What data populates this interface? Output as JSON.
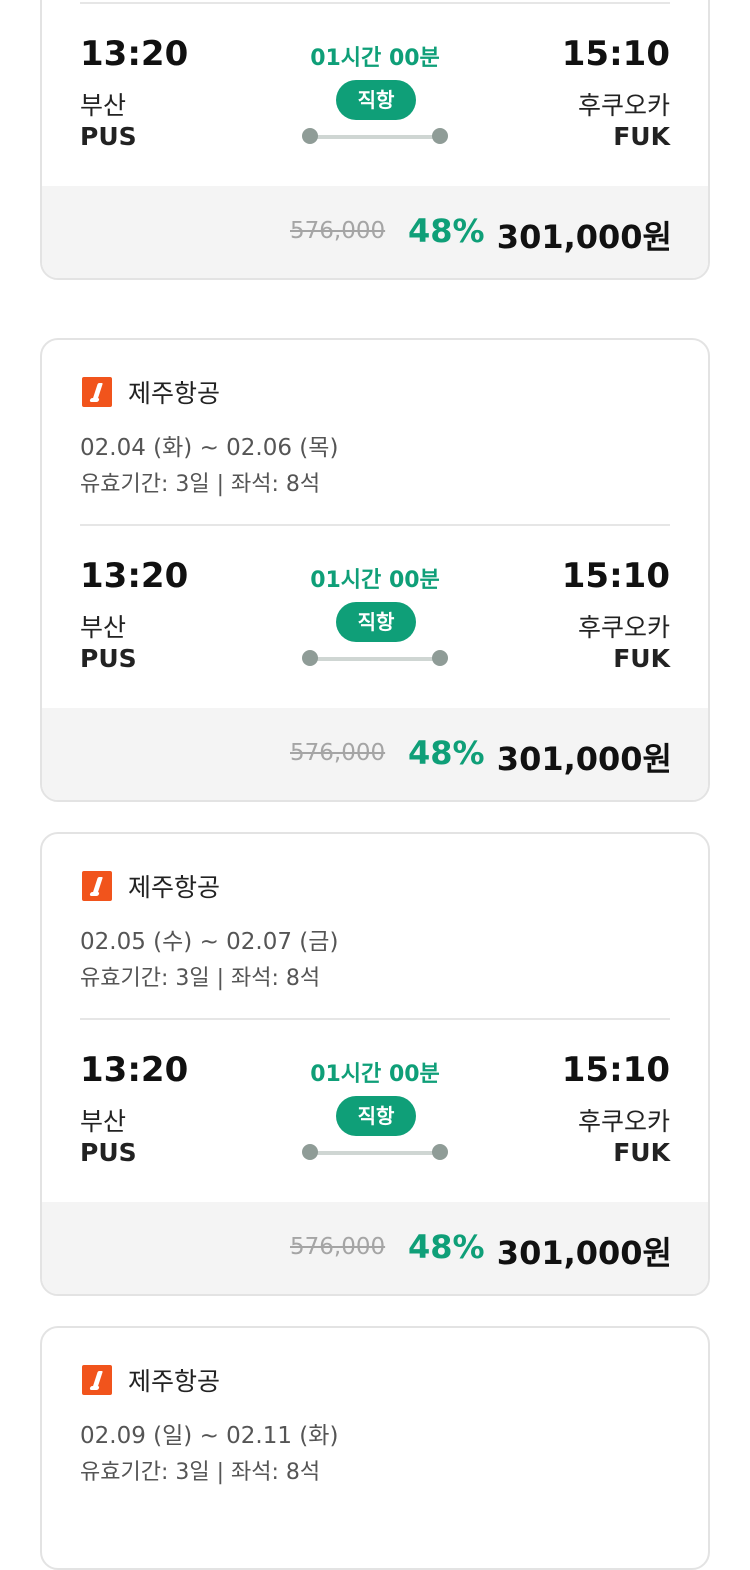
{
  "colors": {
    "accent": "#0f9f78",
    "logo": "#f1541c",
    "price_bar_bg": "#f4f4f4"
  },
  "cards": [
    {
      "airline": "",
      "dates": "",
      "meta": "",
      "flight": {
        "dep_time": "13:20",
        "dep_city": "부산",
        "dep_code": "PUS",
        "duration": "01시간 00분",
        "badge": "직항",
        "arr_time": "15:10",
        "arr_city": "후쿠오카",
        "arr_code": "FUK"
      },
      "price": {
        "original": "576,000",
        "discount": "48%",
        "final": "301,000원"
      }
    },
    {
      "airline": "제주항공",
      "dates": "02.04 (화) ~ 02.06 (목)",
      "meta": "유효기간: 3일 | 좌석: 8석",
      "flight": {
        "dep_time": "13:20",
        "dep_city": "부산",
        "dep_code": "PUS",
        "duration": "01시간 00분",
        "badge": "직항",
        "arr_time": "15:10",
        "arr_city": "후쿠오카",
        "arr_code": "FUK"
      },
      "price": {
        "original": "576,000",
        "discount": "48%",
        "final": "301,000원"
      }
    },
    {
      "airline": "제주항공",
      "dates": "02.05 (수) ~ 02.07 (금)",
      "meta": "유효기간: 3일 | 좌석: 8석",
      "flight": {
        "dep_time": "13:20",
        "dep_city": "부산",
        "dep_code": "PUS",
        "duration": "01시간 00분",
        "badge": "직항",
        "arr_time": "15:10",
        "arr_city": "후쿠오카",
        "arr_code": "FUK"
      },
      "price": {
        "original": "576,000",
        "discount": "48%",
        "final": "301,000원"
      }
    },
    {
      "airline": "제주항공",
      "dates": "02.09 (일) ~ 02.11 (화)",
      "meta": "유효기간: 3일 | 좌석: 8석"
    }
  ]
}
